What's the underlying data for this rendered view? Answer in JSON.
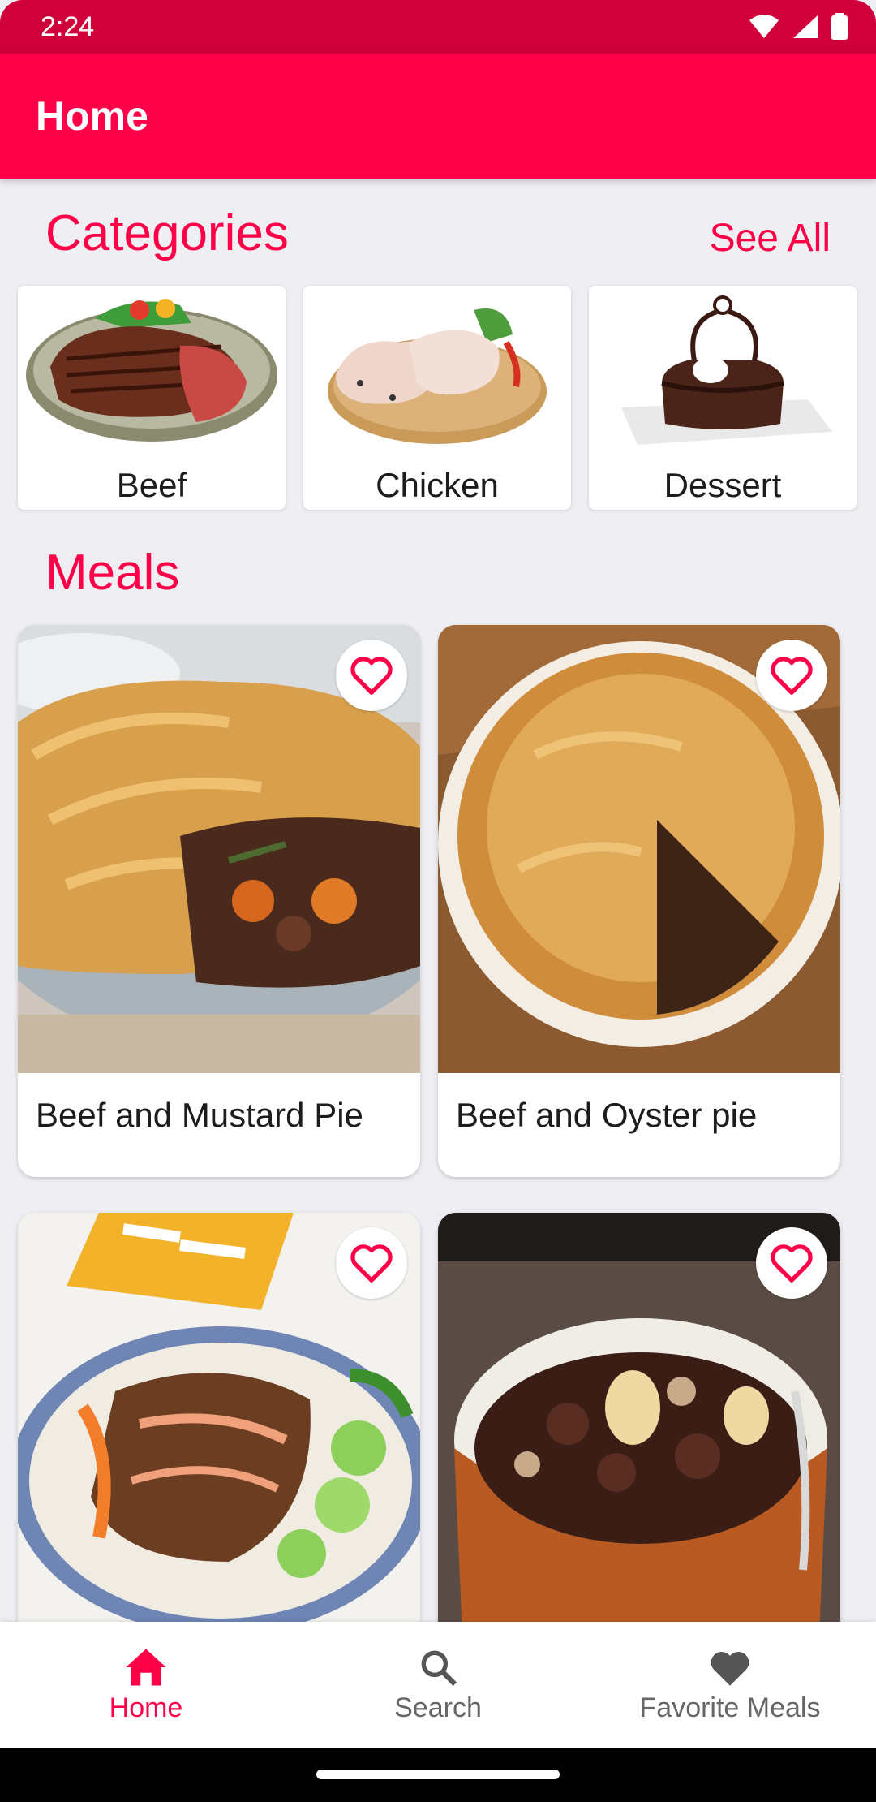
{
  "status_bar": {
    "time": "2:24"
  },
  "app_bar": {
    "title": "Home"
  },
  "categories": {
    "title": "Categories",
    "see_all": "See All",
    "items": [
      {
        "label": "Beef"
      },
      {
        "label": "Chicken"
      },
      {
        "label": "Dessert"
      }
    ]
  },
  "meals": {
    "title": "Meals",
    "items": [
      {
        "name": "Beef and Mustard Pie"
      },
      {
        "name": "Beef and Oyster pie"
      },
      {
        "name": ""
      },
      {
        "name": ""
      }
    ]
  },
  "bottom_nav": {
    "items": [
      {
        "label": "Home",
        "icon": "home-icon",
        "active": true
      },
      {
        "label": "Search",
        "icon": "search-icon",
        "active": false
      },
      {
        "label": "Favorite Meals",
        "icon": "heart-icon",
        "active": false
      }
    ]
  },
  "colors": {
    "primary": "#ff0048",
    "status_bar": "#d0003a",
    "background": "#eeeef3"
  }
}
